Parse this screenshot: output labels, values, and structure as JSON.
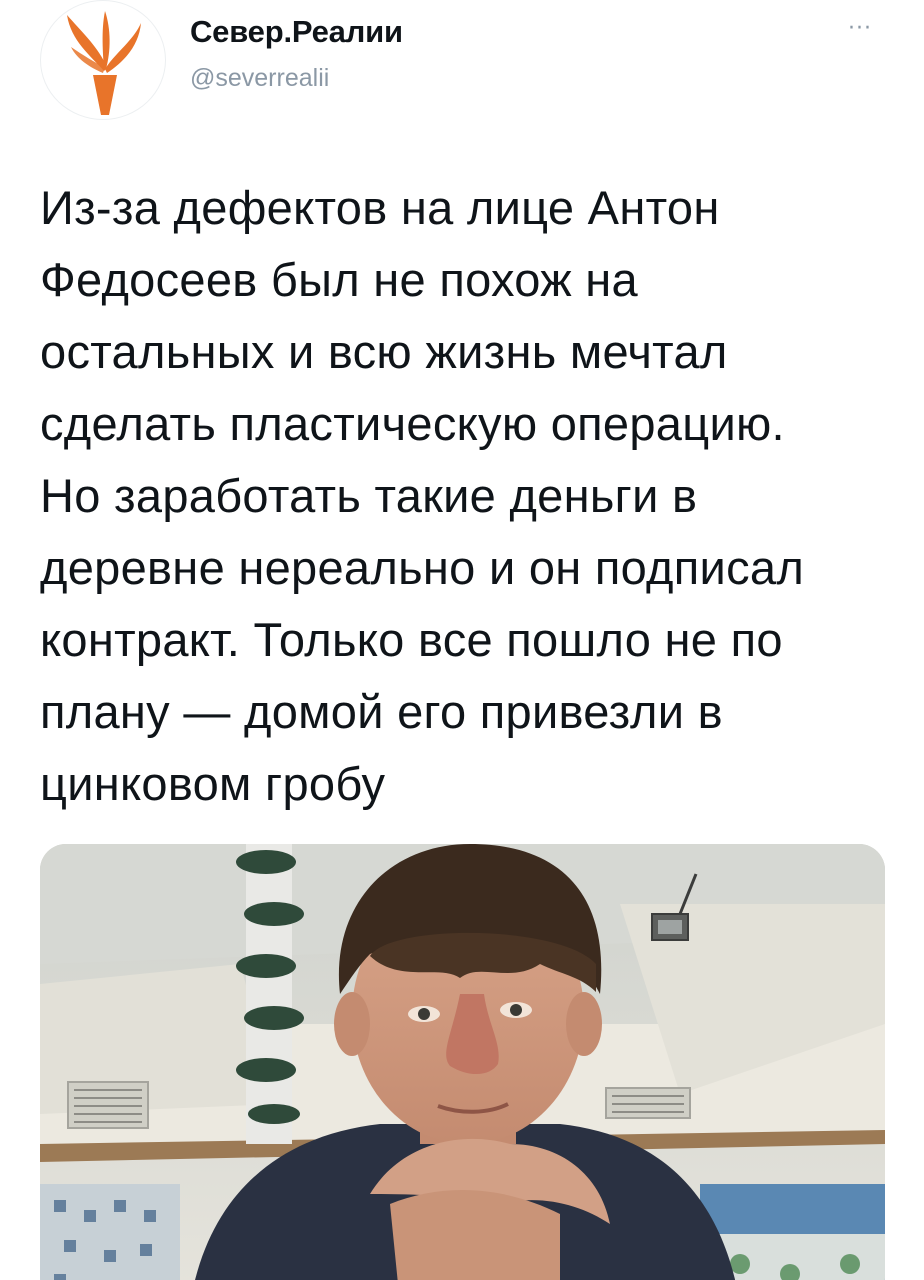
{
  "author": {
    "display_name": "Север.Реалии",
    "handle": "@severrealii",
    "avatar_icon": "torch-logo-icon",
    "avatar_colors": {
      "logo": "#e8742a",
      "background": "#ffffff"
    }
  },
  "header": {
    "more_icon": "more-options-icon",
    "more_label": "···"
  },
  "tweet": {
    "text": "Из-за дефектов на лице Антон\nФедосеев был не похож на\nостальных и всю жизнь мечтал\nсделать пластическую операцию.\nНо заработать такие деньги в\nдеревне нереально и он подписал\nконтракт. Только все пошло не по\nплану —  домой его привезли в\nцинковом гробу"
  },
  "media": {
    "kind": "photo",
    "subject": "tweet-photo"
  },
  "colors": {
    "text": "#0f1419",
    "secondary": "#8b98a5"
  }
}
